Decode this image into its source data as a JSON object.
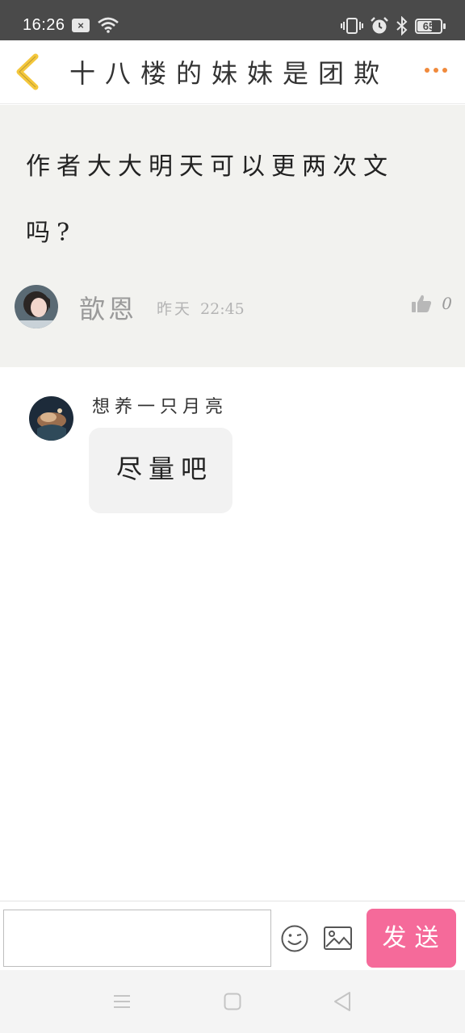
{
  "status_bar": {
    "time": "16:26",
    "notification_badge": "×",
    "battery": "65",
    "battery_level_percent": 65,
    "icons": [
      "notification-icon",
      "wifi-icon",
      "vibrate-icon",
      "alarm-icon",
      "bluetooth-icon",
      "battery-icon"
    ]
  },
  "header": {
    "title": "十八楼的妹妹是团欺",
    "back_icon": "chevron-left-icon",
    "more_icon": "more-dots-icon"
  },
  "post": {
    "content": "作者大大明天可以更两次文吗?",
    "author": "歆恩",
    "date": "昨天",
    "time": "22:45",
    "likes": "0",
    "like_icon": "thumbs-up-icon"
  },
  "reply": {
    "author": "想养一只月亮",
    "text": "尽量吧"
  },
  "input_bar": {
    "placeholder": "",
    "send_label": "发送",
    "emoji_icon": "smiley-icon",
    "image_icon": "image-icon"
  },
  "nav_bar": {
    "icons": [
      "menu-icon",
      "home-icon",
      "back-triangle-icon"
    ]
  },
  "colors": {
    "status_bar": "#4a4a4a",
    "accent_send": "#f56a9a",
    "back_arrow": "#f4c73c",
    "more_dots": "#f08a3c",
    "post_bg": "#f2f2ef"
  }
}
